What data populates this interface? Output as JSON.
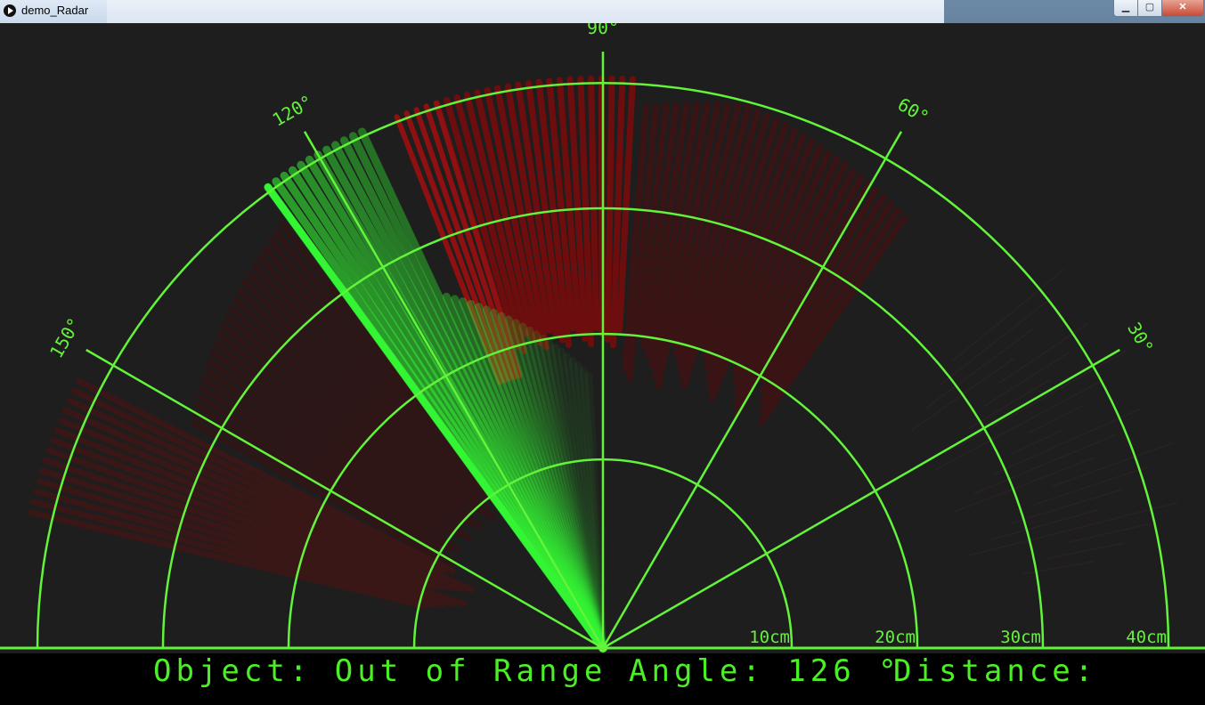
{
  "window": {
    "title": "demo_Radar",
    "min_icon": "minimize-icon",
    "max_icon": "maximize-icon",
    "close_icon": "close-icon"
  },
  "colors": {
    "grid": "#62f33a",
    "sweep": "#34f534",
    "object": "#9e0f0f",
    "background": "#1e1e1e"
  },
  "radar": {
    "angle_labels": [
      "150°",
      "120°",
      "90°",
      "60°",
      "30°"
    ],
    "distance_labels": [
      "10cm",
      "20cm",
      "30cm",
      "40cm"
    ],
    "current_angle": 126
  },
  "status": {
    "object_text": "Object: Out of Range",
    "angle_text": "Angle: 126 °",
    "distance_text": "Distance:"
  }
}
